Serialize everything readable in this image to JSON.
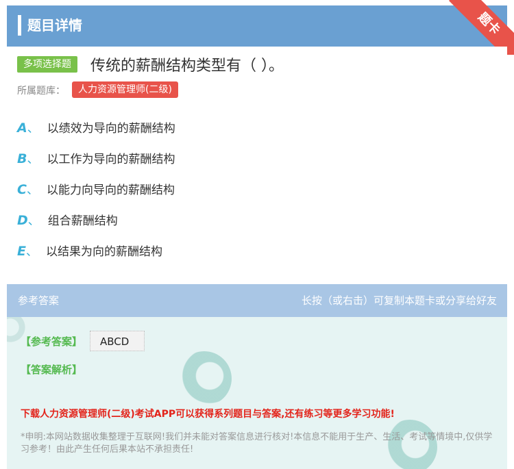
{
  "header": {
    "title": "题目详情",
    "ribbon_label": "题卡"
  },
  "question": {
    "type_badge": "多项选择题",
    "text": "传统的薪酬结构类型有（ ）。",
    "bank_label": "所属题库：",
    "bank_name": "人力资源管理师(二级)"
  },
  "options": [
    {
      "letter": "A",
      "sep": "、",
      "text": "以绩效为导向的薪酬结构"
    },
    {
      "letter": "B",
      "sep": "、",
      "text": "以工作为导向的薪酬结构"
    },
    {
      "letter": "C",
      "sep": "、",
      "text": "以能力向导向的薪酬结构"
    },
    {
      "letter": "D",
      "sep": "、",
      "text": "组合薪酬结构"
    },
    {
      "letter": "E",
      "sep": "、",
      "text": "以结果为向的薪酬结构"
    }
  ],
  "answer_section": {
    "title": "参考答案",
    "hint": "长按（或右击）可复制本题卡或分享给好友",
    "answer_label": "【参考答案】",
    "answer_value": "ABCD",
    "analysis_label": "【答案解析】",
    "promo": "下载人力资源管理师(二级)考试APP可以获得系列题目与答案,还有练习等更多学习功能!",
    "disclaimer": "*申明:本网站数据收集整理于互联网!我们并未能对答案信息进行核对!本信息不能用于生产、生活、考试等情境中,仅供学习参考！由此产生任何后果本站不承担责任!"
  },
  "colors": {
    "header_bg": "#6aa0d2",
    "ribbon": "#e8534a",
    "type_badge": "#79c14a",
    "bank_badge": "#e8534a",
    "option_letter": "#3ab0d8",
    "answer_label": "#54b94f",
    "promo": "#e3241b"
  }
}
